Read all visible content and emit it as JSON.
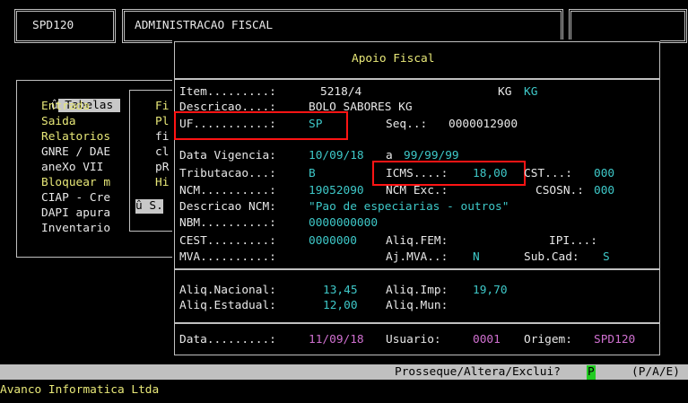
{
  "topbar": {
    "program": "SPD120",
    "title": "ADMINISTRACAO FISCAL"
  },
  "menu": {
    "items": [
      {
        "marker": "û",
        "label": "Tabelas",
        "hot": "T",
        "selected": true
      },
      {
        "label": "Entrada",
        "hot": "E"
      },
      {
        "label": "Saida",
        "hot": "S"
      },
      {
        "label": "Relatorios",
        "hot": "R"
      },
      {
        "label": "GNRE / DAE",
        "hot": "G"
      },
      {
        "label": "aneXo VII",
        "hot": "X"
      },
      {
        "label": "Bloquear m",
        "hot": "B"
      },
      {
        "label": "CIAP - Cre",
        "hot": "C"
      },
      {
        "label": "DAPI apura",
        "hot": "D"
      },
      {
        "label": "Inventario",
        "hot": "I"
      }
    ],
    "sub_items": [
      "Fi",
      "Pl",
      "fi",
      "cl",
      "pR",
      "Hi",
      "û S.",
      ""
    ]
  },
  "dialog": {
    "title": "Apoio Fiscal",
    "item_label": "Item.........:",
    "item_value": "5218/4",
    "unit_label": "KG",
    "unit_value": "KG",
    "descricao_label": "Descricao....:",
    "descricao_value": "BOLO SABORES KG",
    "uf_label": "UF...........:",
    "uf_value": "SP",
    "seq_label": "Seq..:",
    "seq_value": "0000012900",
    "vigencia_label": "Data Vigencia:",
    "vigencia_from": "10/09/18",
    "vigencia_sep": "a",
    "vigencia_to": "99/99/99",
    "tributacao_label": "Tributacao...:",
    "tributacao_value": "B",
    "icms_label": "ICMS....:",
    "icms_value": "18,00",
    "cst_label": "CST...:",
    "cst_value": "000",
    "ncm_label": "NCM..........:",
    "ncm_value": "19052090",
    "ncm_exc_label": "NCM Exc.:",
    "csosn_label": "CSOSN.:",
    "csosn_value": "000",
    "descricao_ncm_label": "Descricao NCM:",
    "descricao_ncm_value": "\"Pao de especiarias - outros\"",
    "nbm_label": "NBM..........:",
    "nbm_value": "0000000000",
    "cest_label": "CEST.........:",
    "cest_value": "0000000",
    "aliq_fem_label": "Aliq.FEM:",
    "ipi_label": "IPI...:",
    "mva_label": "MVA..........:",
    "aj_mva_label": "Aj.MVA..:",
    "aj_mva_value": "N",
    "sub_cad_label": "Sub.Cad:",
    "sub_cad_value": "S",
    "aliq_nacional_label": "Aliq.Nacional:",
    "aliq_nacional_value": "13,45",
    "aliq_imp_label": "Aliq.Imp:",
    "aliq_imp_value": "19,70",
    "aliq_estadual_label": "Aliq.Estadual:",
    "aliq_estadual_value": "12,00",
    "aliq_mun_label": "Aliq.Mun:",
    "data_label": "Data.........:",
    "data_value": "11/09/18",
    "usuario_label": "Usuario:",
    "usuario_value": "0001",
    "origem_label": "Origem:",
    "origem_value": "SPD120"
  },
  "prompt": {
    "question": "Prosseque/Altera/Exclui?",
    "answer": "P",
    "options": "(P/A/E)"
  },
  "footer": {
    "company": "Avanco Informatica Ltda"
  },
  "colors": {
    "background": "#000000",
    "text": "#c0c0c0",
    "value_cyan": "#3ec8c8",
    "value_magenta": "#d070d0",
    "hotkey_yellow": "#e8e878",
    "highlight_box": "#ff1414",
    "status_bar": "#c0c0c0",
    "answer_green": "#22cc22"
  }
}
